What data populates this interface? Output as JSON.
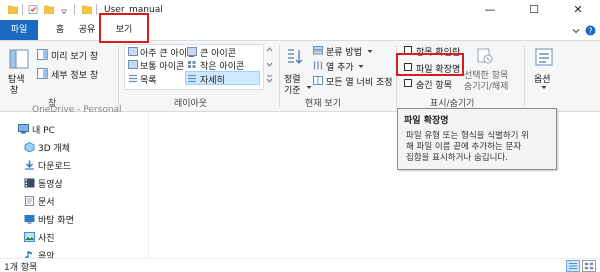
{
  "window": {
    "title": "User_manual",
    "minimize_label": "—",
    "maximize_label": "☐",
    "close_label": "✕"
  },
  "tabs": {
    "file": "파일",
    "home": "홈",
    "share": "공유",
    "view": "보기",
    "expand_icon": "chevron-down",
    "help_icon": "?"
  },
  "ribbon": {
    "pane_group": {
      "nav_pane": "탐색",
      "nav_pane_line2": "창",
      "preview_pane": "미리 보기 창",
      "details_pane": "세부 정보 창",
      "label": "창"
    },
    "layout_group": {
      "items": [
        "아주 큰 아이콘",
        "큰 아이콘",
        "보통 아이콘",
        "작은 아이콘",
        "목록",
        "자세히"
      ],
      "selected": "자세히",
      "label": "레이아웃"
    },
    "view_group": {
      "sort_line1": "정렬",
      "sort_line2": "기준",
      "group_by": "분류 방법",
      "add_column": "열 추가",
      "fit_columns": "모든 열 너비 조정",
      "label": "현재 보기"
    },
    "show_hide_group": {
      "item_checkboxes": "항목 확인란",
      "file_extensions": "파일 확장명",
      "hidden_items": "숨긴 항목",
      "hide_selected_line1": "선택한 항목",
      "hide_selected_line2": "숨기기/해제",
      "label": "표시/숨기기"
    },
    "options": {
      "label": "옵션"
    }
  },
  "tooltip": {
    "title": "파일 확장명",
    "line1": "파일 유형 또는 형식을 식별하기 위",
    "line2": "해 파일 이름 끝에 추가하는 문자",
    "line3": "집합을 표시하거나 숨깁니다."
  },
  "nav": {
    "partial_top": "OneDrive - Personal",
    "items": [
      {
        "label": "내 PC",
        "icon": "pc-icon"
      },
      {
        "label": "3D 개체",
        "icon": "3d-objects-icon"
      },
      {
        "label": "다운로드",
        "icon": "downloads-icon"
      },
      {
        "label": "동영상",
        "icon": "videos-icon"
      },
      {
        "label": "문서",
        "icon": "documents-icon"
      },
      {
        "label": "바탕 화면",
        "icon": "desktop-icon"
      },
      {
        "label": "사진",
        "icon": "pictures-icon"
      },
      {
        "label": "음악",
        "icon": "music-icon"
      }
    ]
  },
  "status": {
    "item_count": "1개 항목"
  },
  "colors": {
    "file_tab": "#1b6ac2",
    "highlight_red": "#d91d1d",
    "selection_blue": "#cde8ff"
  }
}
